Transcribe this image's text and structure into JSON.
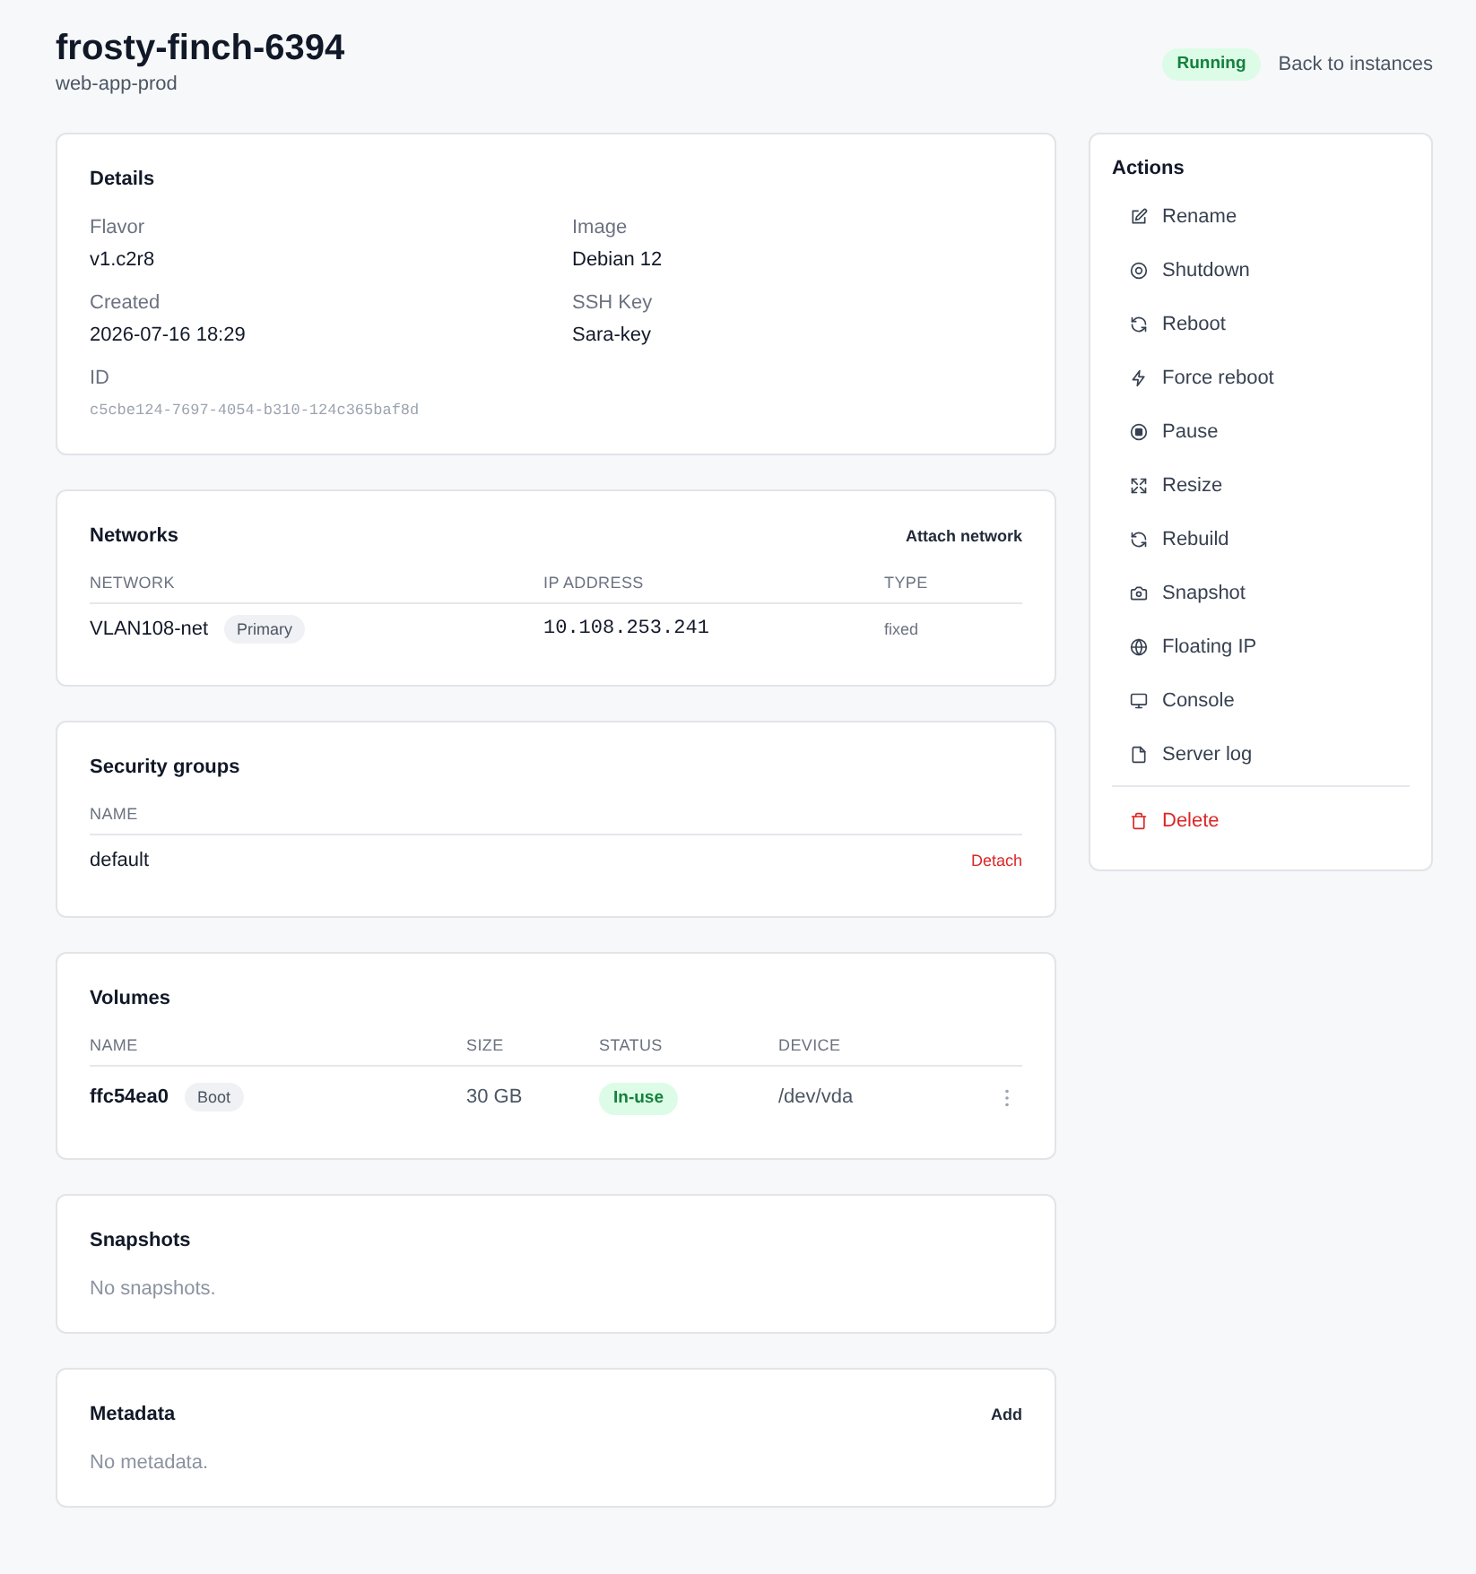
{
  "header": {
    "title": "frosty-finch-6394",
    "subtitle": "web-app-prod",
    "status": "Running",
    "back_link": "Back to instances"
  },
  "details": {
    "title": "Details",
    "fields": [
      {
        "label": "Flavor",
        "value": "v1.c2r8",
        "kind": "text"
      },
      {
        "label": "Image",
        "value": "Debian 12",
        "kind": "text"
      },
      {
        "label": "Created",
        "value": "2026-07-16 18:29",
        "kind": "text"
      },
      {
        "label": "SSH Key",
        "value": "Sara-key",
        "kind": "text"
      },
      {
        "label": "ID",
        "value": "c5cbe124-7697-4054-b310-124c365baf8d",
        "kind": "code"
      }
    ]
  },
  "networks": {
    "title": "Networks",
    "action": "Attach network",
    "columns": [
      "NETWORK",
      "IP ADDRESS",
      "TYPE"
    ],
    "rows": [
      {
        "network": "VLAN108-net",
        "badge": "Primary",
        "ip_address": "10.108.253.241",
        "type": "fixed"
      }
    ]
  },
  "security_groups": {
    "title": "Security groups",
    "columns": [
      "NAME"
    ],
    "rows": [
      {
        "name": "default",
        "action": "Detach"
      }
    ]
  },
  "volumes": {
    "title": "Volumes",
    "columns": [
      "NAME",
      "SIZE",
      "STATUS",
      "DEVICE"
    ],
    "rows": [
      {
        "name": "ffc54ea0",
        "badge": "Boot",
        "size": "30 GB",
        "status": "In-use",
        "device": "/dev/vda"
      }
    ]
  },
  "snapshots": {
    "title": "Snapshots",
    "empty_text": "No snapshots."
  },
  "metadata": {
    "title": "Metadata",
    "action": "Add",
    "empty_text": "No metadata."
  },
  "actions": {
    "title": "Actions",
    "items": [
      {
        "label": "Rename",
        "kind": "default"
      },
      {
        "label": "Shutdown",
        "kind": "default"
      },
      {
        "label": "Reboot",
        "kind": "default"
      },
      {
        "label": "Force reboot",
        "kind": "default"
      },
      {
        "label": "Pause",
        "kind": "default"
      },
      {
        "label": "Resize",
        "kind": "default"
      },
      {
        "label": "Rebuild",
        "kind": "default"
      },
      {
        "label": "Snapshot",
        "kind": "default"
      },
      {
        "label": "Floating IP",
        "kind": "default"
      },
      {
        "label": "Console",
        "kind": "default"
      },
      {
        "label": "Server log",
        "kind": "default"
      },
      {
        "label": "Delete",
        "kind": "danger"
      }
    ]
  }
}
